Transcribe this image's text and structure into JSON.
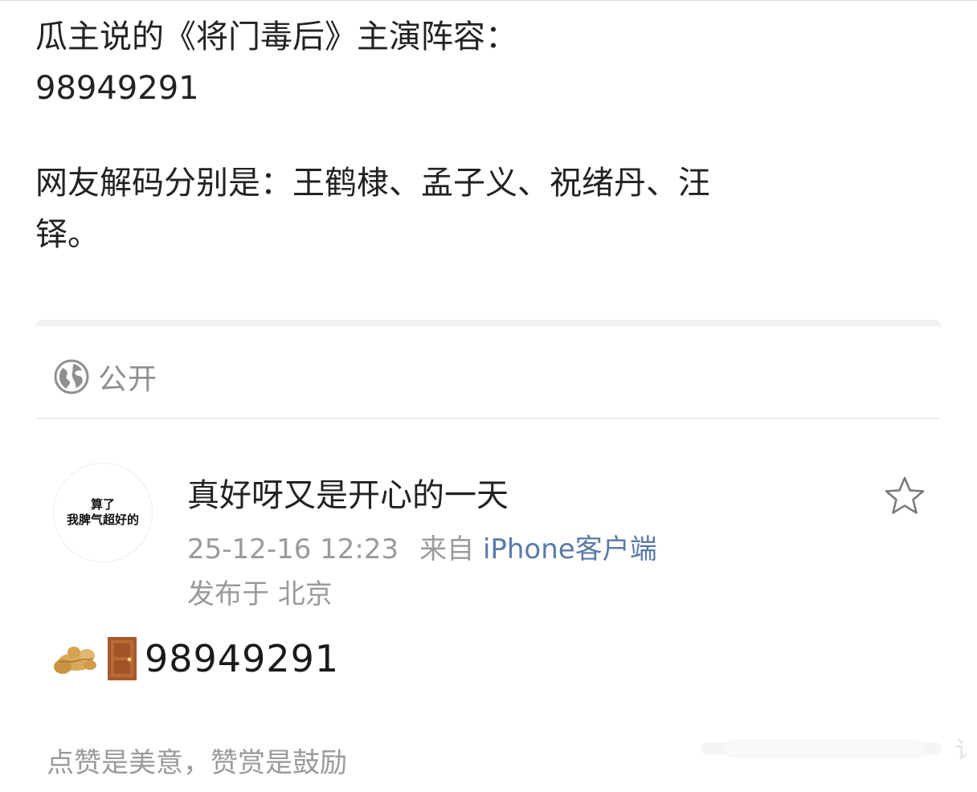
{
  "post": {
    "line1": "瓜主说的《将门毒后》主演阵容：",
    "line2": "98949291",
    "line3": "网友解码分别是：王鹤棣、孟子义、祝绪丹、汪",
    "line4": "铎。"
  },
  "visibility": {
    "icon": "globe-icon",
    "label": "公开"
  },
  "comment": {
    "avatar_line1": "算了",
    "avatar_line2": "我脾气超好的",
    "username": "真好呀又是开心的一天",
    "timestamp": "25-12-16 12:23",
    "from_label": "来自",
    "source": "iPhone客户端",
    "location": "发布于 北京",
    "favorite_icon": "star-outline-icon",
    "emoji": [
      "ginger-emoji",
      "door-emoji"
    ],
    "content_number": "98949291"
  },
  "footer": {
    "text": "点赞是美意，赞赏是鼓励"
  },
  "colors": {
    "link": "#5b7aa5",
    "muted": "#9a9a9a",
    "text": "#222222"
  }
}
